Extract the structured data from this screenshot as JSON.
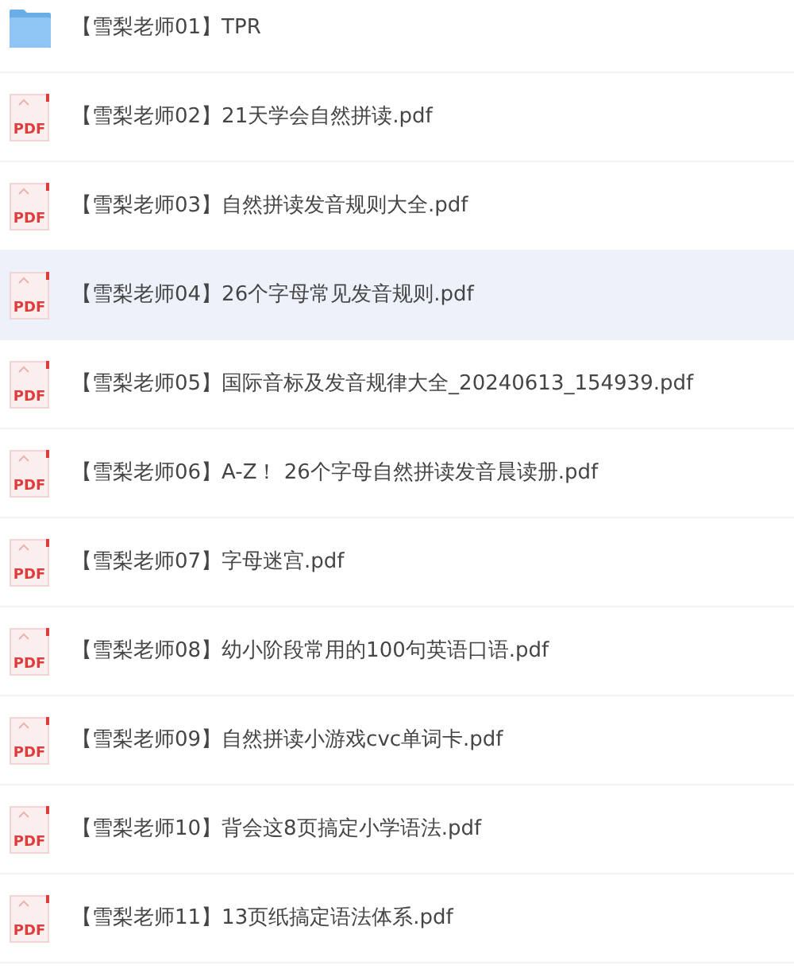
{
  "files": [
    {
      "kind": "folder",
      "name": "【雪梨老师01】TPR",
      "selected": false
    },
    {
      "kind": "pdf",
      "badge": "PDF",
      "name": "【雪梨老师02】21天学会自然拼读.pdf",
      "selected": false
    },
    {
      "kind": "pdf",
      "badge": "PDF",
      "name": "【雪梨老师03】自然拼读发音规则大全.pdf",
      "selected": false
    },
    {
      "kind": "pdf",
      "badge": "PDF",
      "name": "【雪梨老师04】26个字母常见发音规则.pdf",
      "selected": true
    },
    {
      "kind": "pdf",
      "badge": "PDF",
      "name": "【雪梨老师05】国际音标及发音规律大全_20240613_154939.pdf",
      "selected": false
    },
    {
      "kind": "pdf",
      "badge": "PDF",
      "name": "【雪梨老师06】A-Z！ 26个字母自然拼读发音晨读册.pdf",
      "selected": false
    },
    {
      "kind": "pdf",
      "badge": "PDF",
      "name": "【雪梨老师07】字母迷宫.pdf",
      "selected": false
    },
    {
      "kind": "pdf",
      "badge": "PDF",
      "name": "【雪梨老师08】幼小阶段常用的100句英语口语.pdf",
      "selected": false
    },
    {
      "kind": "pdf",
      "badge": "PDF",
      "name": "【雪梨老师09】自然拼读小游戏cvc单词卡.pdf",
      "selected": false
    },
    {
      "kind": "pdf",
      "badge": "PDF",
      "name": "【雪梨老师10】背会这8页搞定小学语法.pdf",
      "selected": false
    },
    {
      "kind": "pdf",
      "badge": "PDF",
      "name": "【雪梨老师11】13页纸搞定语法体系.pdf",
      "selected": false
    }
  ]
}
